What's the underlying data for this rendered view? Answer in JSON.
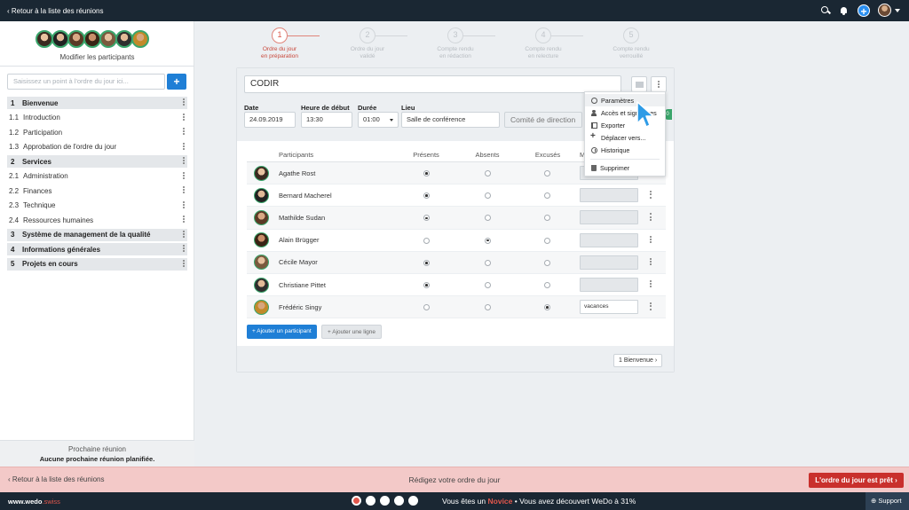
{
  "topbar": {
    "back_label": "‹ Retour à la liste des réunions"
  },
  "sidebar": {
    "modify_participants": "Modifier les participants",
    "agenda_placeholder": "Saisissez un point à l'ordre du jour ici...",
    "add_label": "+",
    "items": [
      {
        "num": "1",
        "label": "Bienvenue",
        "section": true
      },
      {
        "num": "1.1",
        "label": "Introduction",
        "section": false
      },
      {
        "num": "1.2",
        "label": "Participation",
        "section": false
      },
      {
        "num": "1.3",
        "label": "Approbation de l'ordre du jour",
        "section": false
      },
      {
        "num": "2",
        "label": "Services",
        "section": true
      },
      {
        "num": "2.1",
        "label": "Administration",
        "section": false
      },
      {
        "num": "2.2",
        "label": "Finances",
        "section": false
      },
      {
        "num": "2.3",
        "label": "Technique",
        "section": false
      },
      {
        "num": "2.4",
        "label": "Ressources humaines",
        "section": false
      },
      {
        "num": "3",
        "label": "Système de management de la qualité",
        "section": true
      },
      {
        "num": "4",
        "label": "Informations générales",
        "section": true
      },
      {
        "num": "5",
        "label": "Projets en cours",
        "section": true
      }
    ],
    "next_meeting_title": "Prochaine réunion",
    "next_meeting_value": "Aucune prochaine réunion planifiée."
  },
  "stepper": [
    {
      "num": "1",
      "line1": "Ordre du jour",
      "line2": "en préparation",
      "active": true
    },
    {
      "num": "2",
      "line1": "Ordre du jour",
      "line2": "validé",
      "active": false
    },
    {
      "num": "3",
      "line1": "Compte rendu",
      "line2": "en rédaction",
      "active": false
    },
    {
      "num": "4",
      "line1": "Compte rendu",
      "line2": "en relecture",
      "active": false
    },
    {
      "num": "5",
      "line1": "Compte rendu",
      "line2": "verrouillé",
      "active": false
    }
  ],
  "meeting": {
    "title": "CODIR",
    "date_label": "Date",
    "date": "24.09.2019",
    "start_label": "Heure de début",
    "start": "13:30",
    "duration_label": "Durée",
    "duration": "01:00",
    "place_label": "Lieu",
    "place": "Salle de conférence",
    "group": "Comité de direction",
    "badge": "0"
  },
  "table": {
    "headers": {
      "participants": "Participants",
      "present": "Présents",
      "absent": "Absents",
      "excused": "Excusés",
      "reason": "M"
    },
    "rows": [
      {
        "name": "Agathe Rost",
        "status": "present",
        "reason": ""
      },
      {
        "name": "Bernard Macherel",
        "status": "present",
        "reason": ""
      },
      {
        "name": "Mathilde Sudan",
        "status": "present",
        "reason": ""
      },
      {
        "name": "Alain Brügger",
        "status": "absent",
        "reason": ""
      },
      {
        "name": "Cécile Mayor",
        "status": "present",
        "reason": ""
      },
      {
        "name": "Christiane Pittet",
        "status": "present",
        "reason": ""
      },
      {
        "name": "Frédéric Singy",
        "status": "excused",
        "reason": "vacances"
      }
    ],
    "add_participant": "+ Ajouter un participant",
    "add_line": "+ Ajouter une ligne",
    "agenda_link": "1 Bienvenue ›"
  },
  "menu": {
    "items": [
      "Paramètres",
      "Accès et signatures",
      "Exporter",
      "Déplacer vers...",
      "Historique",
      "Supprimer"
    ]
  },
  "banner": {
    "back_label": "‹  Retour à la liste des réunions",
    "message": "Rédigez votre ordre du jour",
    "ready_label": "L'ordre du jour est prêt  ›"
  },
  "footer": {
    "brand": "www.wedo",
    "brand_suffix": ".swiss",
    "status_prefix": "Vous êtes un ",
    "status_level": "Novice",
    "status_suffix": " • Vous avez découvert WeDo à 31%",
    "progress_dots": 5,
    "support_label": "Support"
  },
  "colors": {
    "accent_blue": "#1f7fd6",
    "active_step": "#c8473a",
    "present_green": "#3aa56b",
    "ready_red": "#c9302c",
    "dark_bar": "#1a2733"
  }
}
